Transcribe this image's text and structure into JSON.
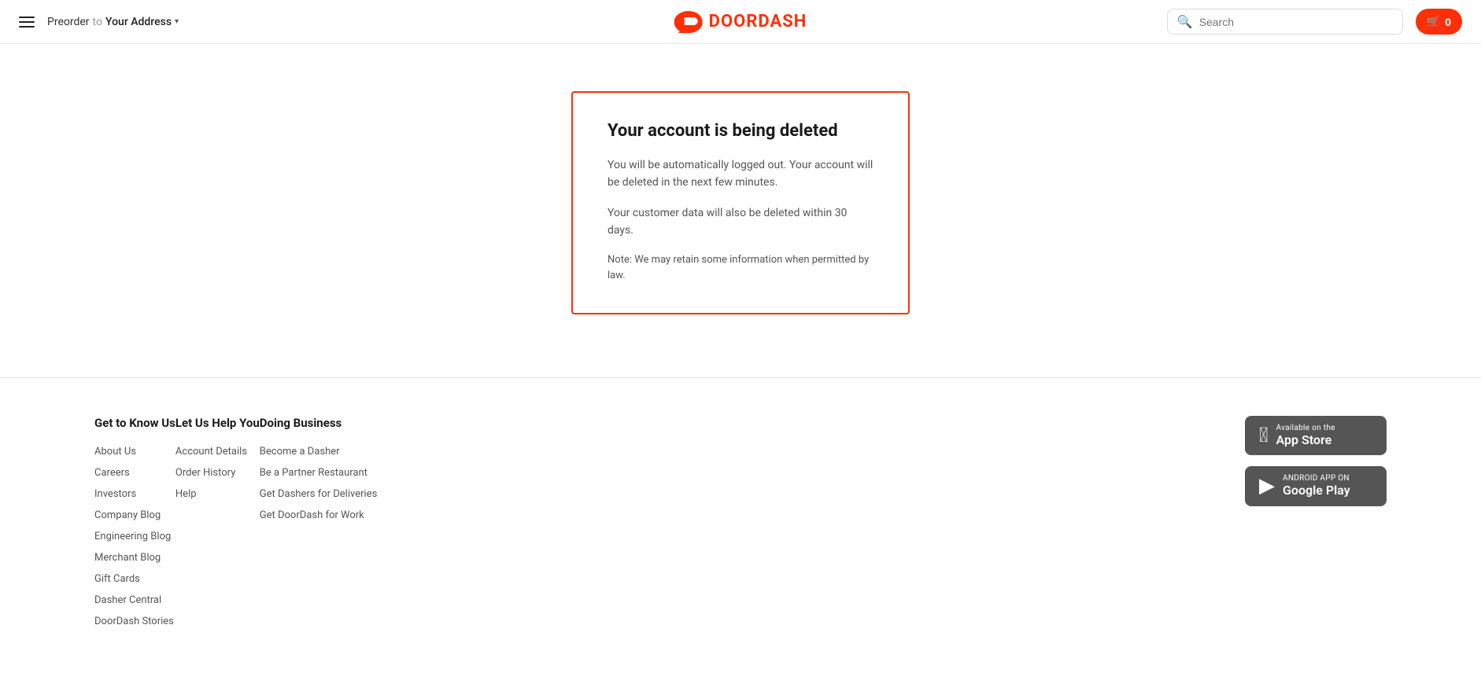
{
  "header": {
    "hamburger_label": "menu",
    "preorder_label": "Preorder",
    "preorder_to": "to",
    "address_label": "Your Address",
    "logo_text": "DOORDASH",
    "search_placeholder": "Search",
    "cart_icon": "🛒",
    "cart_count": "0"
  },
  "main": {
    "title": "Your account is being deleted",
    "para1": "You will be automatically logged out. Your account will be deleted in the next few minutes.",
    "para2": "Your customer data will also be deleted within 30 days.",
    "note": "Note: We may retain some information when permitted by law."
  },
  "footer": {
    "col1": {
      "title": "Get to Know Us",
      "links": [
        "About Us",
        "Careers",
        "Investors",
        "Company Blog",
        "Engineering Blog",
        "Merchant Blog",
        "Gift Cards",
        "Dasher Central",
        "DoorDash Stories"
      ]
    },
    "col2": {
      "title": "Let Us Help You",
      "links": [
        "Account Details",
        "Order History",
        "Help"
      ]
    },
    "col3": {
      "title": "Doing Business",
      "links": [
        "Become a Dasher",
        "Be a Partner Restaurant",
        "Get Dashers for Deliveries",
        "Get DoorDash for Work"
      ]
    },
    "apps": {
      "app_store_small": "Available on the",
      "app_store_big": "App Store",
      "google_play_small": "ANDROID APP ON",
      "google_play_big": "Google Play"
    }
  }
}
